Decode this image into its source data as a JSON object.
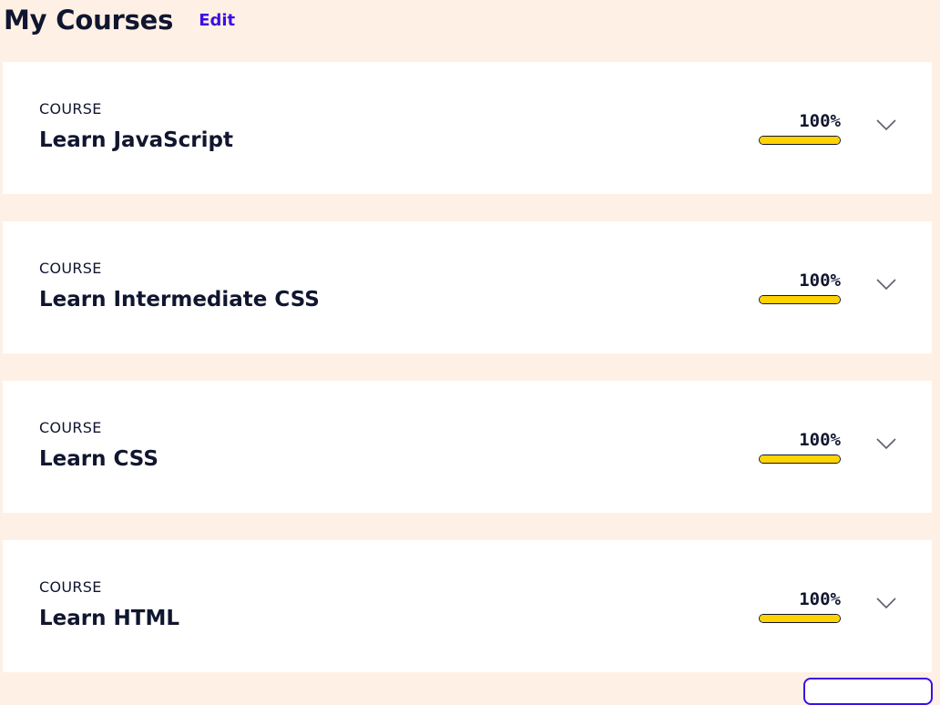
{
  "header": {
    "title": "My Courses",
    "edit_label": "Edit"
  },
  "courses": [
    {
      "kind": "COURSE",
      "title": "Learn JavaScript",
      "progress_label": "100%",
      "progress": 1.0
    },
    {
      "kind": "COURSE",
      "title": "Learn Intermediate CSS",
      "progress_label": "100%",
      "progress": 1.0
    },
    {
      "kind": "COURSE",
      "title": "Learn CSS",
      "progress_label": "100%",
      "progress": 1.0
    },
    {
      "kind": "COURSE",
      "title": "Learn HTML",
      "progress_label": "100%",
      "progress": 1.0
    }
  ],
  "colors": {
    "background": "#fff0e5",
    "card": "#ffffff",
    "text": "#10162f",
    "accent": "#3a10e5",
    "progress_fill": "#ffd300"
  },
  "icons": {
    "expand": "chevron-down-icon"
  }
}
